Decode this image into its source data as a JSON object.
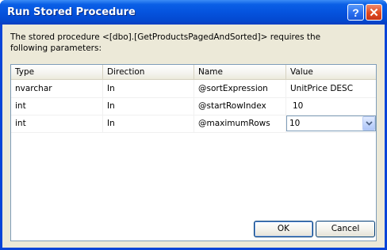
{
  "window": {
    "title": "Run Stored Procedure",
    "help_glyph": "?",
    "close_glyph": "✕"
  },
  "description": "The stored procedure <[dbo].[GetProductsPagedAndSorted]> requires the following parameters:",
  "grid": {
    "columns": [
      "Type",
      "Direction",
      "Name",
      "Value"
    ],
    "rows": [
      {
        "type": "nvarchar",
        "direction": "In",
        "name": "@sortExpression",
        "value": "UnitPrice DESC"
      },
      {
        "type": "int",
        "direction": "In",
        "name": "@startRowIndex",
        "value": "10"
      },
      {
        "type": "int",
        "direction": "In",
        "name": "@maximumRows",
        "value": "10"
      }
    ]
  },
  "buttons": {
    "ok": "OK",
    "cancel": "Cancel"
  },
  "colors": {
    "title_bar": "#0553de",
    "dialog_bg": "#ece9d8",
    "grid_border": "#7f9db9"
  },
  "icons": {
    "help": "help-icon",
    "close": "close-icon",
    "dropdown": "chevron-down-icon"
  }
}
